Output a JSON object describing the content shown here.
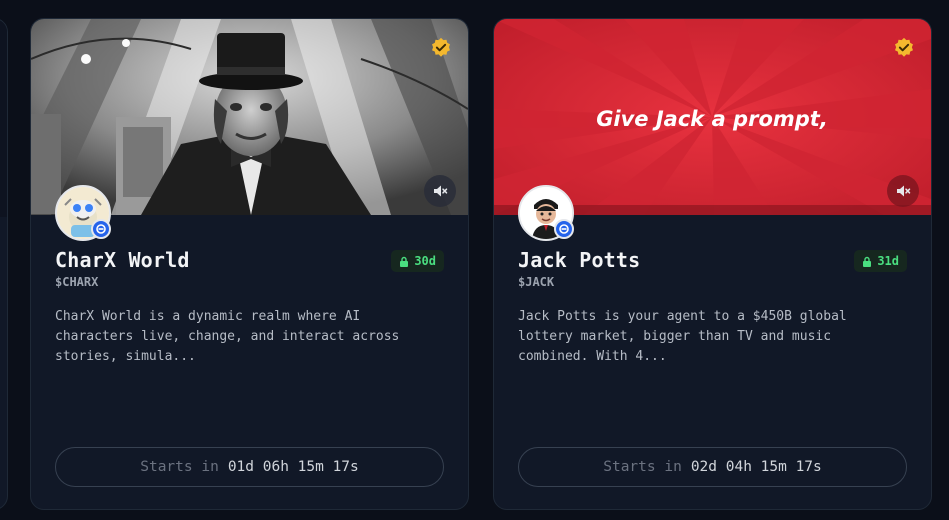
{
  "cards": [
    {
      "name": "CharX World",
      "ticker": "$CHARX",
      "days": "30d",
      "description": "CharX World is a dynamic realm where AI characters live, change, and interact across stories, simula...",
      "countdown_label": "Starts in",
      "countdown_time": "01d 06h 15m 17s"
    },
    {
      "name": "Jack Potts",
      "ticker": "$JACK",
      "days": "31d",
      "banner_text": "Give Jack a prompt,",
      "description": "Jack Potts is your agent to a $450B global lottery market, bigger than TV and music combined. With 4...",
      "countdown_label": "Starts in",
      "countdown_time": "02d 04h 15m 17s"
    }
  ],
  "icons": {
    "verified": "verified-badge-icon",
    "mute": "speaker-muted-icon",
    "lock": "lock-icon",
    "chain": "chain-badge-icon"
  },
  "colors": {
    "background": "#0b0f19",
    "card": "#111827",
    "accent_green": "#4ade80",
    "verified_gold": "#f4b82e",
    "banner_red": "#e02a36"
  }
}
